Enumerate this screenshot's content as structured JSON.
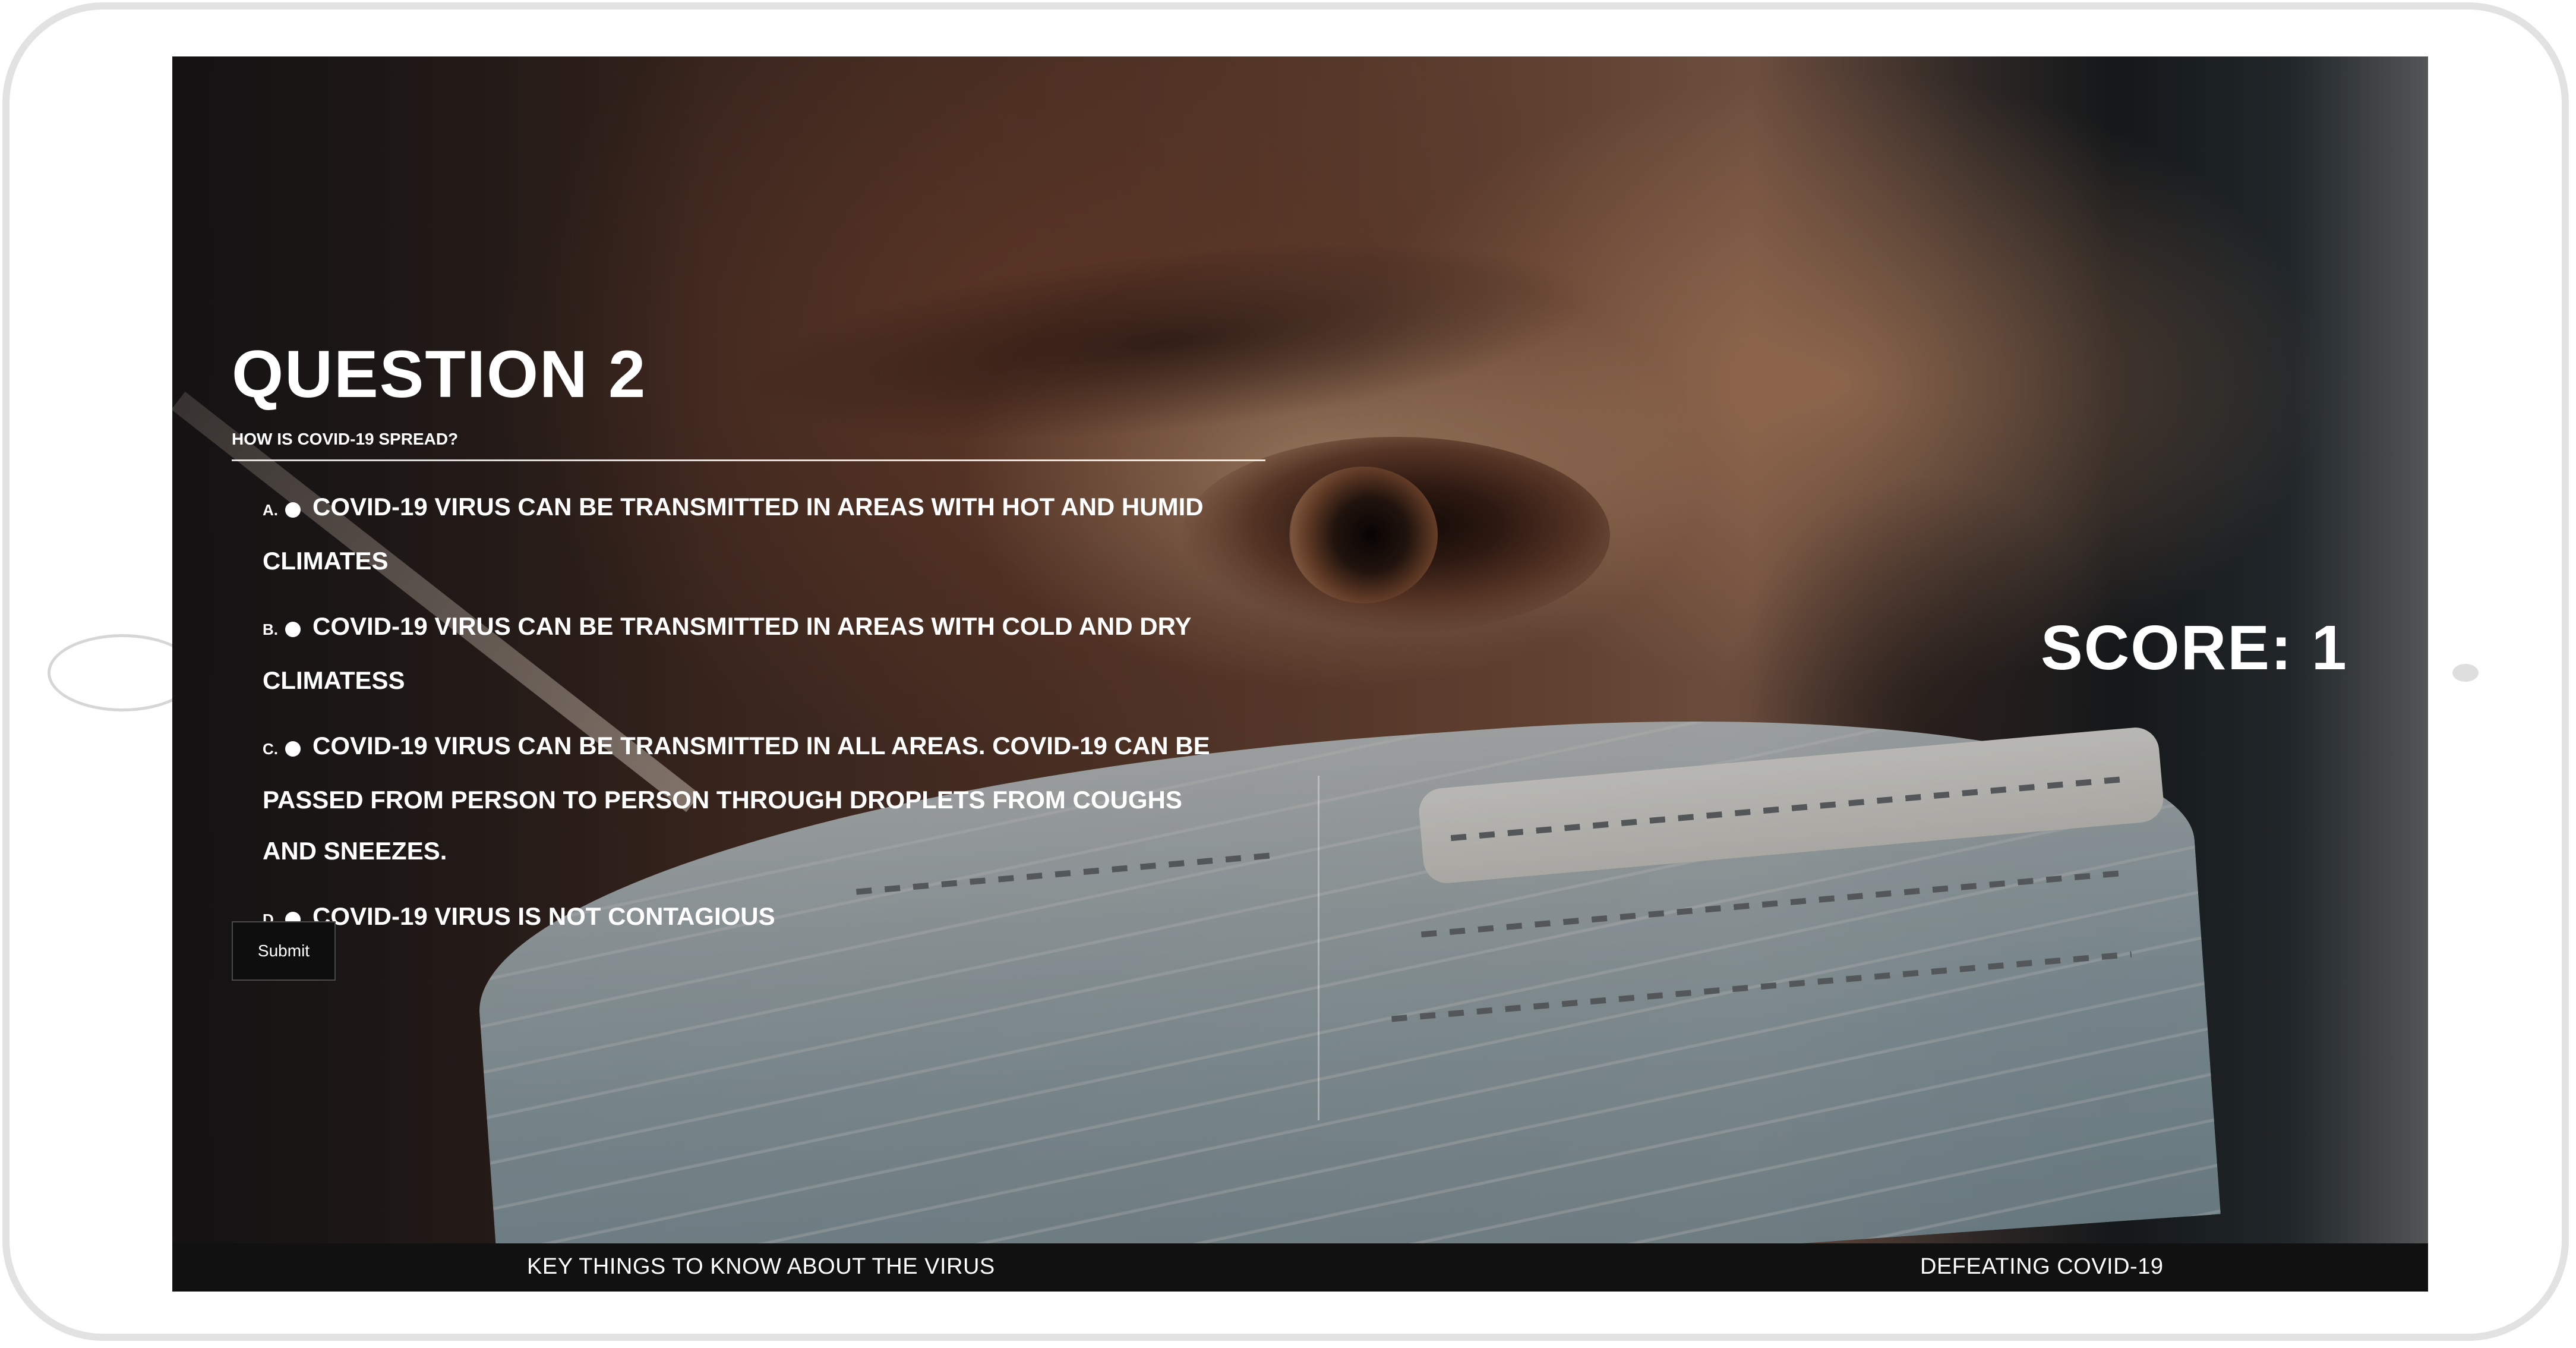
{
  "quiz": {
    "title": "QUESTION 2",
    "question": "HOW IS COVID-19 SPREAD?",
    "options": [
      {
        "marker": "A.",
        "text": "COVID-19 VIRUS CAN BE TRANSMITTED IN AREAS WITH HOT AND HUMID CLIMATES"
      },
      {
        "marker": "B.",
        "text": "COVID-19 VIRUS CAN BE TRANSMITTED IN AREAS WITH COLD AND DRY CLIMATESS"
      },
      {
        "marker": "C.",
        "text": "COVID-19 VIRUS CAN BE TRANSMITTED IN ALL AREAS. COVID-19 CAN BE PASSED FROM PERSON TO PERSON THROUGH DROPLETS FROM COUGHS AND SNEEZES."
      },
      {
        "marker": "D.",
        "text": "COVID-19 VIRUS IS NOT CONTAGIOUS"
      }
    ],
    "submit_label": "Submit"
  },
  "score": {
    "label": "SCORE: 1"
  },
  "footer": {
    "nav_left": "KEY THINGS TO KNOW ABOUT THE VIRUS",
    "nav_right": "DEFEATING COVID-19"
  },
  "colors": {
    "footer_bg": "#121112",
    "text": "#ffffff",
    "button_bg": "#0e0e0e"
  }
}
